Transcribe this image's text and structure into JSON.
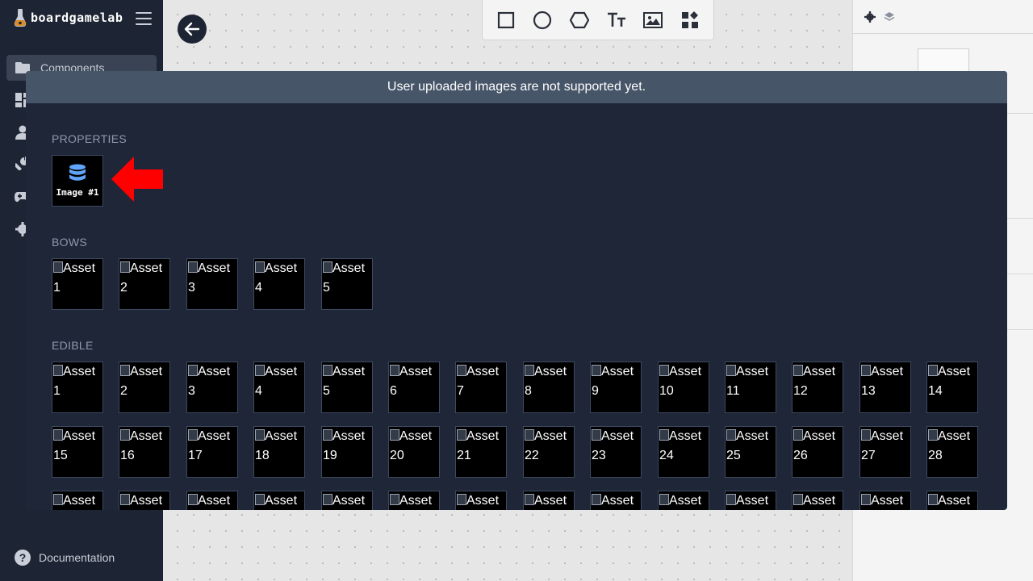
{
  "app": {
    "name": "boardgamelab"
  },
  "sidebar": {
    "items": [
      {
        "label": "Components",
        "icon": "folder-icon"
      },
      {
        "label": "",
        "icon": "grid-icon"
      },
      {
        "label": "",
        "icon": "person-icon"
      },
      {
        "label": "",
        "icon": "wrench-icon"
      },
      {
        "label": "",
        "icon": "gamepad-icon"
      },
      {
        "label": "",
        "icon": "gear-icon"
      }
    ],
    "documentation": "Documentation"
  },
  "toolbar": {
    "tools": [
      "rectangle-tool-icon",
      "circle-tool-icon",
      "hexagon-tool-icon",
      "text-tool-icon",
      "image-tool-icon",
      "widgets-tool-icon"
    ]
  },
  "modal": {
    "banner": "User uploaded images are not supported yet.",
    "sections": {
      "properties": {
        "title": "PROPERTIES",
        "item_label": "Image #1"
      },
      "bows": {
        "title": "BOWS",
        "assets": [
          "Asset 1",
          "Asset 2",
          "Asset 3",
          "Asset 4",
          "Asset 5"
        ]
      },
      "edible": {
        "title": "EDIBLE",
        "assets": [
          "Asset 1",
          "Asset 2",
          "Asset 3",
          "Asset 4",
          "Asset 5",
          "Asset 6",
          "Asset 7",
          "Asset 8",
          "Asset 9",
          "Asset 10",
          "Asset 11",
          "Asset 12",
          "Asset 13",
          "Asset 14",
          "Asset 15",
          "Asset 16",
          "Asset 17",
          "Asset 18",
          "Asset 19",
          "Asset 20",
          "Asset 21",
          "Asset 22",
          "Asset 23",
          "Asset 24",
          "Asset 25",
          "Asset 26",
          "Asset 27",
          "Asset 28",
          "Asset",
          "Asset",
          "Asset",
          "Asset",
          "Asset",
          "Asset",
          "Asset",
          "Asset",
          "Asset",
          "Asset",
          "Asset",
          "Asset",
          "Asset",
          "Asset"
        ]
      }
    }
  },
  "colors": {
    "sidebar_bg": "#1d2433",
    "modal_bg": "#1e2638",
    "banner_bg": "#475569",
    "accent_blue": "#60a5fa",
    "arrow_red": "#ff0000"
  }
}
